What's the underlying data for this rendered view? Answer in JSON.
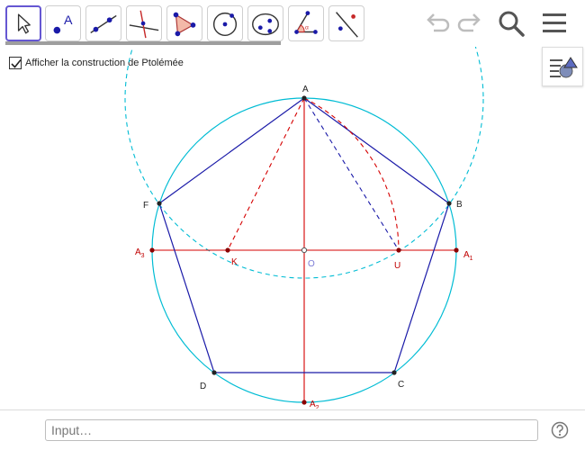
{
  "toolbar": {
    "tools": [
      {
        "name": "move-tool",
        "label": ""
      },
      {
        "name": "point-tool",
        "label": "A"
      },
      {
        "name": "line-tool",
        "label": ""
      },
      {
        "name": "perpendicular-line-tool",
        "label": ""
      },
      {
        "name": "polygon-tool",
        "label": ""
      },
      {
        "name": "circle-center-point-tool",
        "label": ""
      },
      {
        "name": "ellipse-tool",
        "label": ""
      },
      {
        "name": "angle-tool",
        "label": "α"
      },
      {
        "name": "reflect-tool",
        "label": ""
      }
    ],
    "right_icons": [
      "undo-icon",
      "redo-icon",
      "search-icon",
      "menu-icon"
    ]
  },
  "checkbox": {
    "label": "Afficher la construction de Ptolémée",
    "checked": true
  },
  "points": {
    "A": "A",
    "B": "B",
    "C": "C",
    "D": "D",
    "F": "F",
    "K": "K",
    "U": "U",
    "O": "O",
    "A1": "A",
    "A1_sub": "1",
    "A2": "A",
    "A2_sub": "2",
    "A3": "A",
    "A3_sub": "3"
  },
  "input": {
    "placeholder": "Input…"
  },
  "colors": {
    "accent": "#6557d2",
    "circle": "#00bcd4",
    "pentagon": "#1a1aa8",
    "construction_red": "#d50000",
    "label_red": "#c00000"
  }
}
